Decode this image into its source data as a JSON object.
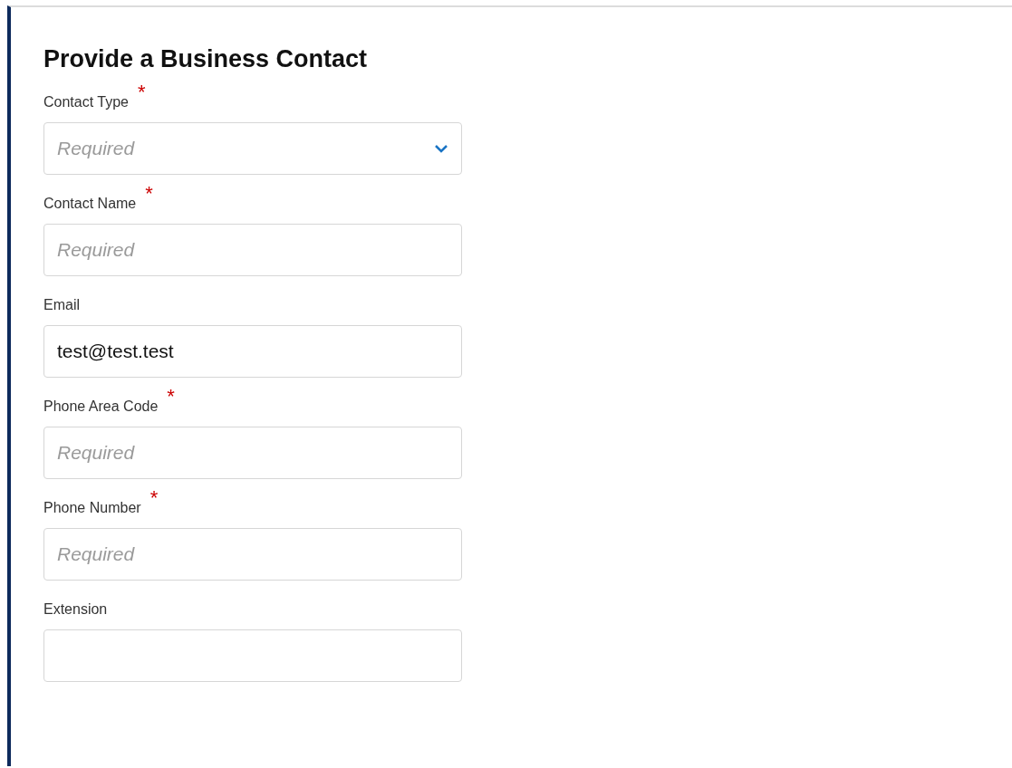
{
  "form": {
    "title": "Provide a Business Contact",
    "fields": [
      {
        "kind": "select",
        "label": "Contact Type",
        "required_mark": "*",
        "placeholder": "Required"
      },
      {
        "kind": "text",
        "label": "Contact Name",
        "required_mark": "*",
        "placeholder": "Required"
      },
      {
        "kind": "text",
        "label": "Email",
        "value": "test@test.test"
      },
      {
        "kind": "text",
        "label": "Phone Area Code",
        "required_mark": "*",
        "placeholder": "Required"
      },
      {
        "kind": "text",
        "label": "Phone Number",
        "required_mark": "*",
        "placeholder": "Required"
      },
      {
        "kind": "text",
        "label": "Extension"
      }
    ]
  }
}
